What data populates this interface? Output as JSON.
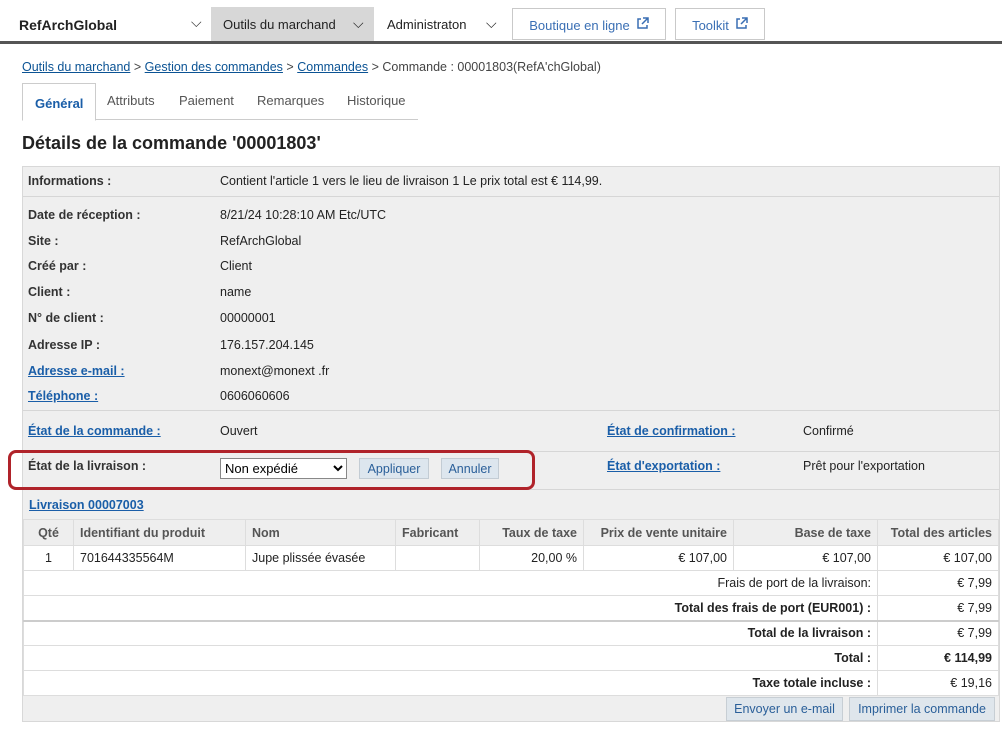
{
  "header": {
    "brand": "RefArchGlobal",
    "tab_merchant": "Outils du marchand",
    "tab_admin": "Administraton",
    "storefront": "Boutique en ligne",
    "toolkit": "Toolkit"
  },
  "breadcrumb": {
    "item1": "Outils du marchand",
    "item2": "Gestion des commandes",
    "item3": "Commandes",
    "current": "Commande : 00001803(RefA'chGlobal)",
    "sep": ">"
  },
  "tabs": [
    "Général",
    "Attributs",
    "Paiement",
    "Remarques",
    "Historique"
  ],
  "page_title": "Détails de la commande '00001803'",
  "info": {
    "informations_label": "Informations :",
    "informations_value": "Contient l'article 1 vers le lieu de livraison 1 Le prix total est € 114,99.",
    "date_label": "Date de réception :",
    "date_value": "8/21/24 10:28:10 AM Etc/UTC",
    "site_label": "Site :",
    "site_value": "RefArchGlobal",
    "created_label": "Créé par :",
    "created_value": "Client",
    "client_label": "Client :",
    "client_value": "name",
    "client_no_label": "N° de client :",
    "client_no_value": "00000001",
    "ip_label": "Adresse IP :",
    "ip_value": "176.157.204.145",
    "email_label": "Adresse e-mail :",
    "email_value": "monext@monext .fr",
    "phone_label": "Téléphone :",
    "phone_value": "0606060606"
  },
  "status": {
    "order_state_label": "État de la commande :",
    "order_state_value": "Ouvert",
    "confirm_label": "État de confirmation :",
    "confirm_value": "Confirmé",
    "delivery_label": "État de la livraison :",
    "delivery_value": "Non expédié",
    "apply": "Appliquer",
    "cancel": "Annuler",
    "export_label": "État d'exportation :",
    "export_value": "Prêt pour l'exportation"
  },
  "shipment": {
    "link": "Livraison 00007003",
    "columns": [
      "Qté",
      "Identifiant du produit",
      "Nom",
      "Fabricant",
      "Taux de taxe",
      "Prix de vente unitaire",
      "Base de taxe",
      "Total des articles"
    ],
    "rows": [
      {
        "qty": "1",
        "product_id": "701644335564M",
        "name": "Jupe plissée évasée",
        "manufacturer": "",
        "tax_rate": "20,00 %",
        "unit_price": "€ 107,00",
        "tax_base": "€ 107,00",
        "total": "€ 107,00"
      }
    ],
    "shipping_fee_label": "Frais de port de la livraison:",
    "shipping_fee_value": "€ 7,99",
    "total_shipping_label": "Total des frais de port (EUR001) :",
    "total_shipping_value": "€ 7,99",
    "delivery_total_label": "Total de la livraison :",
    "delivery_total_value": "€ 7,99",
    "total_label": "Total :",
    "total_value": "€ 114,99",
    "tax_label": "Taxe totale incluse :",
    "tax_value": "€ 19,16"
  },
  "footer": {
    "send_email": "Envoyer un e-mail",
    "print": "Imprimer la commande"
  },
  "colors": {
    "accent": "#1a5ea8",
    "highlight": "#b0232a"
  },
  "icons": [
    "chevron-down-icon",
    "external-link-icon"
  ]
}
